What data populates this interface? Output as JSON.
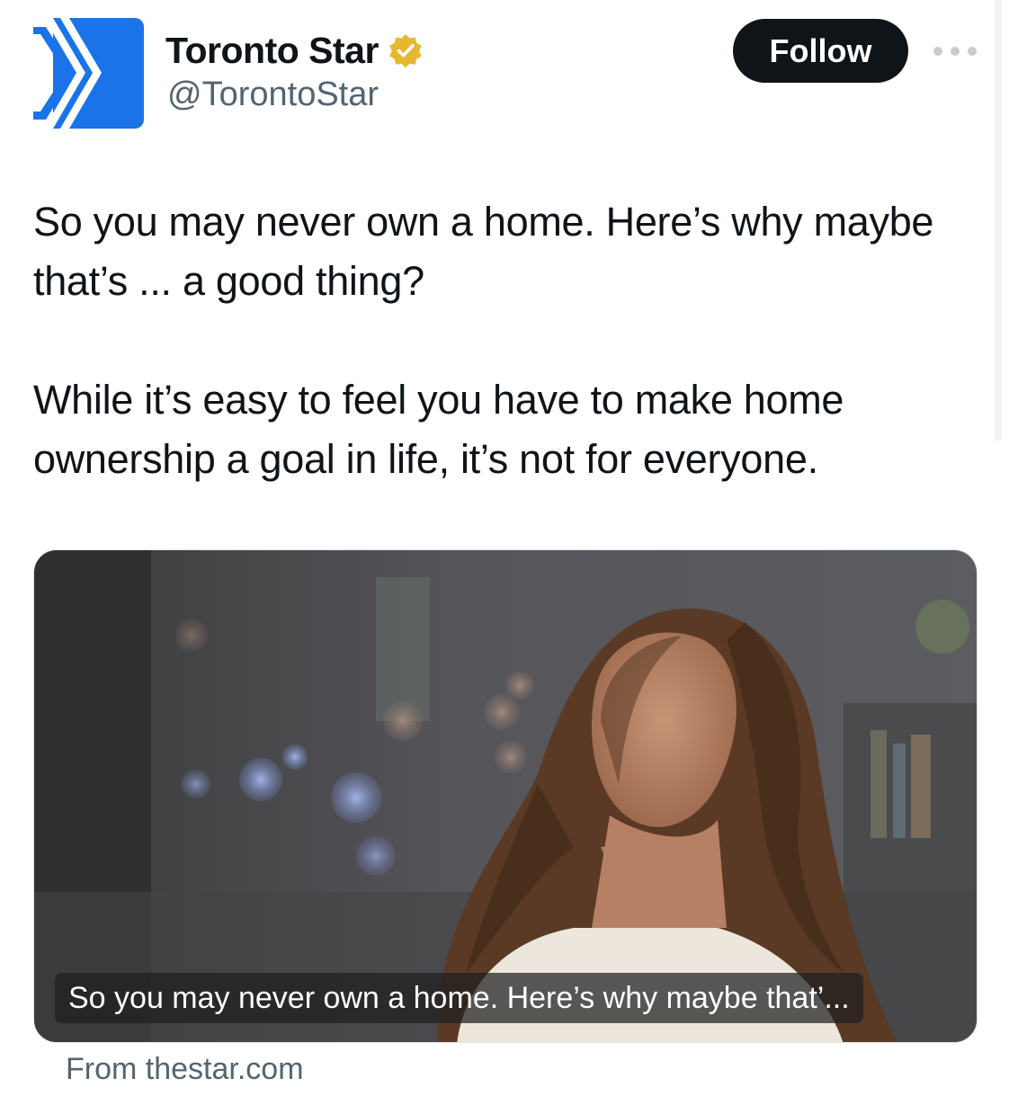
{
  "account": {
    "display_name": "Toronto Star",
    "handle": "@TorontoStar",
    "verified": true,
    "avatar_color": "#1a73e8"
  },
  "actions": {
    "follow_label": "Follow",
    "more_icon": "more-horizontal-icon"
  },
  "tweet": {
    "paragraphs": [
      "So you may never own a home. Here’s why maybe that’s ... a good thing?",
      "While it’s easy to feel you have to make home ownership a goal in life, it’s not for everyone."
    ]
  },
  "card": {
    "title": "So you may never own a home. Here’s why maybe that’...",
    "source": "From thestar.com"
  },
  "colors": {
    "text_primary": "#0f1419",
    "text_secondary": "#536471",
    "follow_bg": "#0f1419",
    "badge_gold": "#e8b730"
  }
}
